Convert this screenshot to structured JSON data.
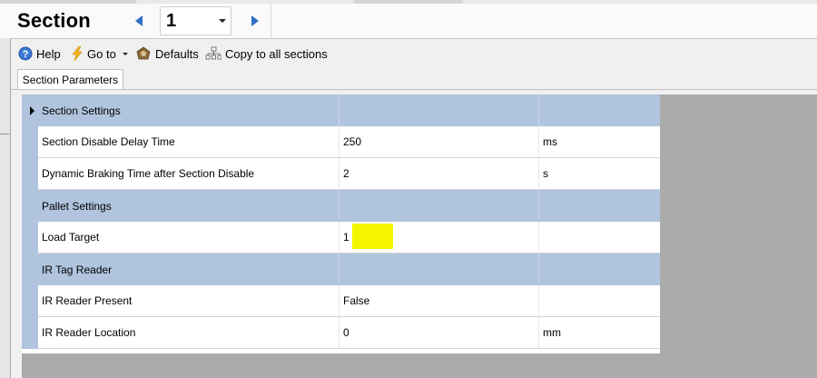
{
  "header": {
    "title": "Section",
    "section_number": "1"
  },
  "toolbar": {
    "help_label": "Help",
    "goto_label": "Go to",
    "defaults_label": "Defaults",
    "copy_label": "Copy to all sections"
  },
  "tabs": [
    {
      "label": "Section Parameters",
      "active": true
    }
  ],
  "grid": {
    "rows": [
      {
        "type": "category",
        "name": "Section Settings",
        "value": "",
        "unit": ""
      },
      {
        "type": "property",
        "name": "Section Disable Delay Time",
        "value": "250",
        "unit": "ms"
      },
      {
        "type": "property",
        "name": "Dynamic Braking Time after Section Disable",
        "value": "2",
        "unit": "s"
      },
      {
        "type": "category",
        "name": "Pallet Settings",
        "value": "",
        "unit": ""
      },
      {
        "type": "property",
        "name": "Load Target",
        "value": "1",
        "unit": "",
        "highlighted": true
      },
      {
        "type": "category",
        "name": "IR Tag Reader",
        "value": "",
        "unit": ""
      },
      {
        "type": "property",
        "name": "IR Reader Present",
        "value": "False",
        "unit": ""
      },
      {
        "type": "property",
        "name": "IR Reader Location",
        "value": "0",
        "unit": "mm"
      }
    ]
  },
  "colors": {
    "category_band": "#b0c4de",
    "highlight": "#f5f500",
    "nav_arrow": "#2f6fc6",
    "grid_background": "#ababab"
  },
  "icons": {
    "help": "help-icon",
    "goto": "lightning-icon",
    "defaults": "defaults-icon",
    "copy": "hierarchy-icon"
  }
}
